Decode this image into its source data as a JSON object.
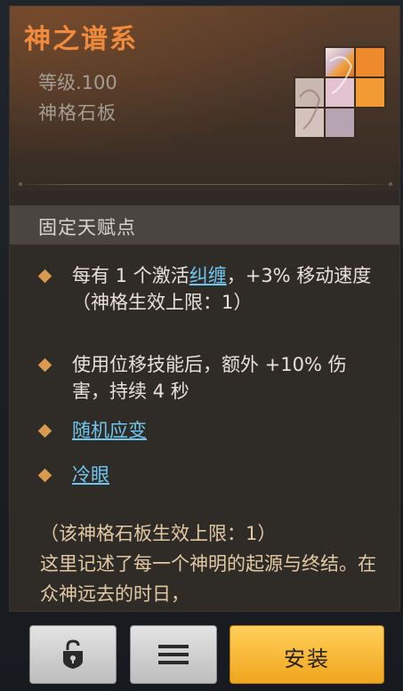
{
  "panel": {
    "title": "神之谱系",
    "level": "等级.100",
    "item_type": "神格石板",
    "board_icon": "god-slate-icon"
  },
  "section": {
    "fixed_talent_title": "固定天赋点"
  },
  "talents": [
    {
      "prefix": "每有 1 个激活",
      "link": "纠缠",
      "suffix": "，+3% 移动速度（神格生效上限：1）"
    },
    {
      "text": "使用位移技能后，额外 +10% 伤害，持续 4 秒"
    },
    {
      "link": "随机应变"
    },
    {
      "link": "冷眼"
    }
  ],
  "lore": {
    "limit": "（该神格石板生效上限：1）",
    "text": "这里记述了每一个神明的起源与终结。在众神远去的时日，"
  },
  "buttons": {
    "lock_icon": "unlock-shield-icon",
    "menu_icon": "menu-icon",
    "install": "安装"
  },
  "colors": {
    "title": "#f08a3c",
    "link": "#6fc7f0",
    "bullet": "#d89a4e",
    "install_button": "#f0a51d",
    "lore_text": "#e3c9a4"
  }
}
